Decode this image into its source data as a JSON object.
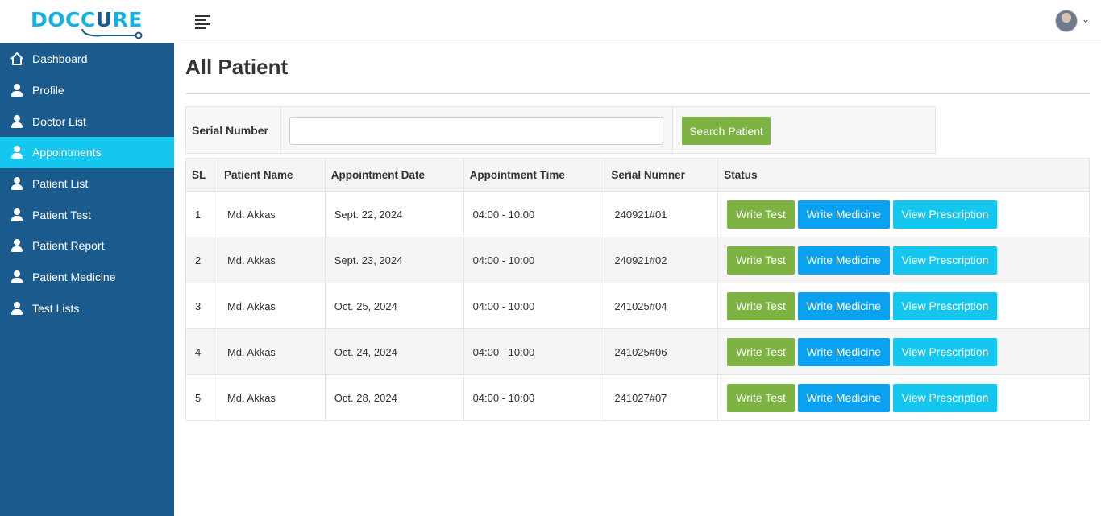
{
  "brand": {
    "logo_part1": "DOCC",
    "logo_part2": "U",
    "logo_part3": "RE"
  },
  "colors": {
    "sidebar": "#1b5a8c",
    "active": "#15c7ef",
    "green": "#7cb342",
    "blue": "#0aa1f1"
  },
  "sidebar": {
    "items": [
      {
        "label": "Dashboard",
        "icon": "home-icon"
      },
      {
        "label": "Profile",
        "icon": "user-icon"
      },
      {
        "label": "Doctor List",
        "icon": "user-icon"
      },
      {
        "label": "Appointments",
        "icon": "user-icon",
        "active": true
      },
      {
        "label": "Patient List",
        "icon": "user-icon"
      },
      {
        "label": "Patient Test",
        "icon": "user-icon"
      },
      {
        "label": "Patient Report",
        "icon": "user-icon"
      },
      {
        "label": "Patient Medicine",
        "icon": "user-icon"
      },
      {
        "label": "Test Lists",
        "icon": "user-icon"
      }
    ]
  },
  "main": {
    "title": "All Patient",
    "search": {
      "label": "Serial Number",
      "value": "",
      "button": "Search Patient"
    },
    "table": {
      "headers": [
        "SL",
        "Patient Name",
        "Appointment Date",
        "Appointment Time",
        "Serial Numner",
        "Status"
      ],
      "rows": [
        {
          "sl": "1",
          "name": "Md. Akkas",
          "date": "Sept. 22, 2024",
          "time": "04:00 - 10:00",
          "serial": "240921#01"
        },
        {
          "sl": "2",
          "name": "Md. Akkas",
          "date": "Sept. 23, 2024",
          "time": "04:00 - 10:00",
          "serial": "240921#02"
        },
        {
          "sl": "3",
          "name": "Md. Akkas",
          "date": "Oct. 25, 2024",
          "time": "04:00 - 10:00",
          "serial": "241025#04"
        },
        {
          "sl": "4",
          "name": "Md. Akkas",
          "date": "Oct. 24, 2024",
          "time": "04:00 - 10:00",
          "serial": "241025#06"
        },
        {
          "sl": "5",
          "name": "Md. Akkas",
          "date": "Oct. 28, 2024",
          "time": "04:00 - 10:00",
          "serial": "241027#07"
        }
      ],
      "actions": {
        "write_test": "Write Test",
        "write_medicine": "Write Medicine",
        "view_prescription": "View Prescription"
      }
    }
  }
}
